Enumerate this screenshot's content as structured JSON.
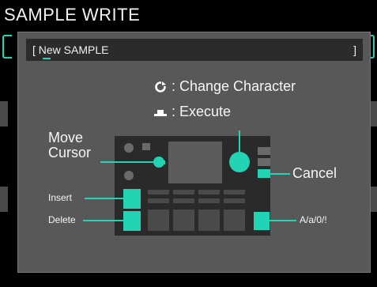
{
  "header": {
    "title": "SAMPLE WRITE"
  },
  "name_field": {
    "open_bracket": "[",
    "value": "New SAMPLE",
    "close_bracket": "]"
  },
  "legend": {
    "change_character": ": Change Character",
    "execute": ": Execute",
    "change_icon": "rotary-dial-icon",
    "execute_icon": "button-press-icon"
  },
  "callouts": {
    "move_cursor_line1": "Move",
    "move_cursor_line2": "Cursor",
    "cancel": "Cancel",
    "insert": "Insert",
    "delete": "Delete",
    "case_toggle": "A/a/0/!"
  },
  "colors": {
    "accent": "#22d3b4",
    "dialog_bg": "#585858",
    "device_bg": "#2a2a2a"
  }
}
